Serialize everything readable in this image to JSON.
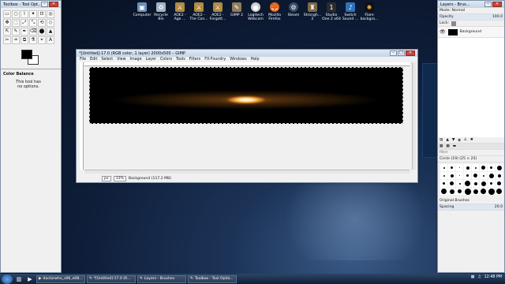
{
  "desktop": {
    "icons": [
      {
        "label": "Computer",
        "icon": "computer-icon",
        "color": "#6a8fb8"
      },
      {
        "label": "Recycle Bin",
        "icon": "recycle-bin-icon",
        "color": "#9fb3c8"
      },
      {
        "label": "AOE2 - Age ...",
        "icon": "aoe2-icon",
        "color": "#b08a3e"
      },
      {
        "label": "AOE2 - The Con...",
        "icon": "aoe2-conquerors-icon",
        "color": "#b08a3e"
      },
      {
        "label": "AOE2 - Forgott...",
        "icon": "aoe2-forgotten-icon",
        "color": "#b08a3e"
      },
      {
        "label": "GIMP 2",
        "icon": "gimp-icon",
        "color": "#8f7c5c"
      },
      {
        "label": "Logitech Webcam",
        "icon": "webcam-icon",
        "color": "#cfcfcf"
      },
      {
        "label": "Mozilla Firefox",
        "icon": "firefox-icon",
        "color": "#e26b1e"
      },
      {
        "label": "Steam",
        "icon": "steam-icon",
        "color": "#3b4f68"
      },
      {
        "label": "Strongh... 2",
        "icon": "stronghold-icon",
        "color": "#7b6a46"
      },
      {
        "label": "Studio One 2 x64",
        "icon": "studio-one-icon",
        "color": "#2c2c2c"
      },
      {
        "label": "Switch Sound ...",
        "icon": "switch-sound-icon",
        "color": "#2e73b8"
      },
      {
        "label": "Flare backgro...",
        "icon": "flare-background-icon",
        "color": "#111111"
      }
    ]
  },
  "toolbox": {
    "title": "Toolbox - Tool Opt...",
    "tool_options_title": "Color Balance",
    "tool_options_text": "This tool has no options.",
    "tools": [
      "▭",
      "○",
      "⌇",
      "✦",
      "⊡",
      "◎",
      "✥",
      "⬚",
      "⤢",
      "⤡",
      "⟲",
      "◇",
      "⇱",
      "✎",
      "✒",
      "⌫",
      "⬤",
      "▲",
      "✂",
      "♒",
      "⧉",
      "⚗",
      "⌖",
      "A"
    ]
  },
  "image_window": {
    "title": "*[Untitled]-17.0 (RGB color, 1 layer) 2000x500 – GIMP",
    "menus": [
      "File",
      "Edit",
      "Select",
      "View",
      "Image",
      "Layer",
      "Colors",
      "Tools",
      "Filters",
      "FX-Foundry",
      "Windows",
      "Help"
    ],
    "status_unit": "px",
    "status_zoom": "33%",
    "status_text": "Background (117.2 MB)"
  },
  "layers_dock": {
    "title": "Layers - Brus...",
    "mode_label": "Mode: Normal",
    "opacity_label": "Opacity",
    "opacity_value": "100.0",
    "lock_label": "Lock:",
    "layer_name": "Background",
    "brush_filter": "filter",
    "brush_name": "Circle (19) (25 × 25)",
    "brush_set": "Original Brushes",
    "spacing_label": "Spacing",
    "spacing_value": "20.0"
  },
  "taskbar": {
    "tasks": [
      {
        "label": "doctorwho_s06_e08...",
        "icon": "video-icon"
      },
      {
        "label": "*[Untitled]-17.0 (R...",
        "icon": "gimp-icon"
      },
      {
        "label": "Layers - Brushes",
        "icon": "gimp-icon"
      },
      {
        "label": "Toolbox - Tool Optio...",
        "icon": "gimp-icon"
      }
    ],
    "clock": "12:48 PM"
  }
}
